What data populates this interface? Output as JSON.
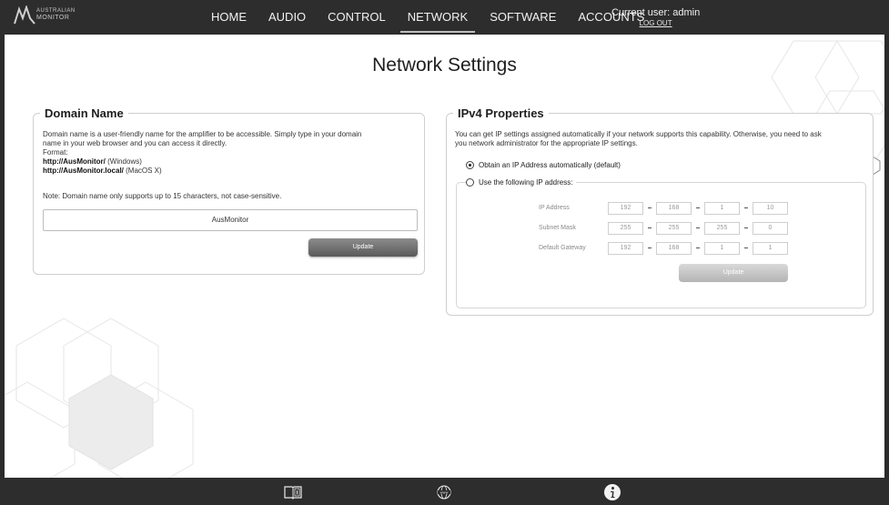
{
  "app": {
    "logo_line1": "AUSTRALIAN",
    "logo_line2": "MONITOR"
  },
  "nav": {
    "items": [
      {
        "label": "HOME"
      },
      {
        "label": "AUDIO"
      },
      {
        "label": "CONTROL"
      },
      {
        "label": "NETWORK",
        "active": true
      },
      {
        "label": "SOFTWARE"
      },
      {
        "label": "ACCOUNTS"
      }
    ],
    "user_label": "Current user: admin",
    "logout_label": "LOG OUT"
  },
  "page": {
    "title": "Network Settings"
  },
  "domain": {
    "legend": "Domain Name",
    "description_line1": "Domain name is a user-friendly name for the amplifier to be accessible. Simply type in your domain",
    "description_line2": "name in your web browser and you can access it directly.",
    "format_label": "Format:",
    "url_windows": "http://AusMonitor/",
    "url_windows_suffix": " (Windows)",
    "url_mac": "http://AusMonitor.local/",
    "url_mac_suffix": " (MacOS X)",
    "note": "Note: Domain name only supports up to 15 characters, not case-sensitive.",
    "input_value": "AusMonitor",
    "update_label": "Update"
  },
  "ipv4": {
    "legend": "IPv4 Properties",
    "description_line1": "You can get IP settings assigned automatically if your network supports this capability. Otherwise, you need to ask",
    "description_line2": "you network administrator for the appropriate IP settings.",
    "option_auto": "Obtain an IP Address automatically (default)",
    "option_manual": "Use the following IP address:",
    "selected": "auto",
    "rows": [
      {
        "label": "IP Address",
        "octets": [
          "192",
          "168",
          "1",
          "10"
        ]
      },
      {
        "label": "Subnet Mask",
        "octets": [
          "255",
          "255",
          "255",
          "0"
        ]
      },
      {
        "label": "Default Gateway",
        "octets": [
          "192",
          "168",
          "1",
          "1"
        ]
      }
    ],
    "update_label": "Update"
  },
  "footer": {
    "icons": [
      "manual-book-icon",
      "www-globe-icon",
      "info-icon"
    ]
  },
  "colors": {
    "bar": "#2d2d2d",
    "button_dark": "#6e6e6e",
    "button_disabled": "#c4c4c4"
  }
}
